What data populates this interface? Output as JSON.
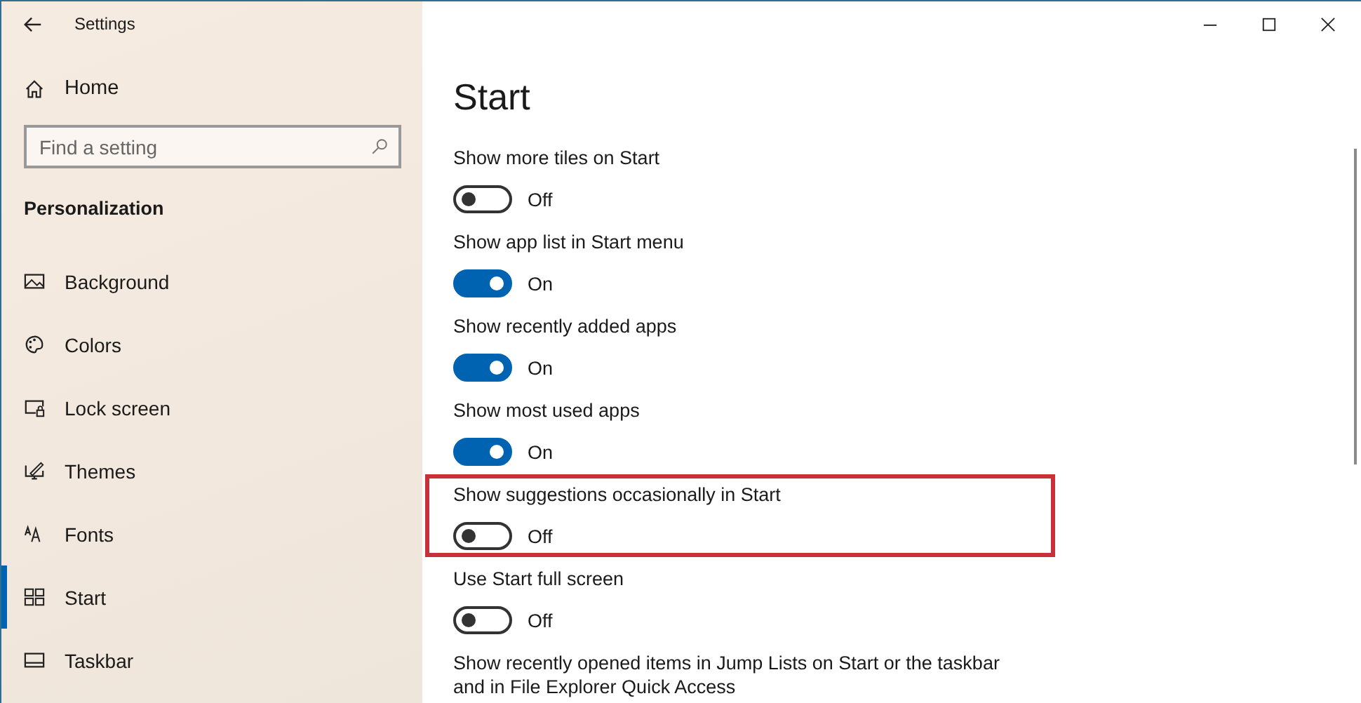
{
  "window": {
    "title": "Settings"
  },
  "sidebar": {
    "home": "Home",
    "search": {
      "placeholder": "Find a setting"
    },
    "section": "Personalization",
    "items": [
      {
        "label": "Background",
        "selected": false
      },
      {
        "label": "Colors",
        "selected": false
      },
      {
        "label": "Lock screen",
        "selected": false
      },
      {
        "label": "Themes",
        "selected": false
      },
      {
        "label": "Fonts",
        "selected": false
      },
      {
        "label": "Start",
        "selected": true
      },
      {
        "label": "Taskbar",
        "selected": false
      }
    ]
  },
  "page": {
    "title": "Start",
    "settings": [
      {
        "kind": "toggle",
        "label": "Show more tiles on Start",
        "on": false,
        "state_text": "Off",
        "highlighted": false
      },
      {
        "kind": "toggle",
        "label": "Show app list in Start menu",
        "on": true,
        "state_text": "On",
        "highlighted": false
      },
      {
        "kind": "toggle",
        "label": "Show recently added apps",
        "on": true,
        "state_text": "On",
        "highlighted": false
      },
      {
        "kind": "toggle",
        "label": "Show most used apps",
        "on": true,
        "state_text": "On",
        "highlighted": false
      },
      {
        "kind": "toggle",
        "label": "Show suggestions occasionally in Start",
        "on": false,
        "state_text": "Off",
        "highlighted": true
      },
      {
        "kind": "toggle",
        "label": "Use Start full screen",
        "on": false,
        "state_text": "Off",
        "highlighted": false
      },
      {
        "kind": "text",
        "label": "Show recently opened items in Jump Lists on Start or the taskbar and in File Explorer Quick Access",
        "highlighted": false
      }
    ]
  }
}
